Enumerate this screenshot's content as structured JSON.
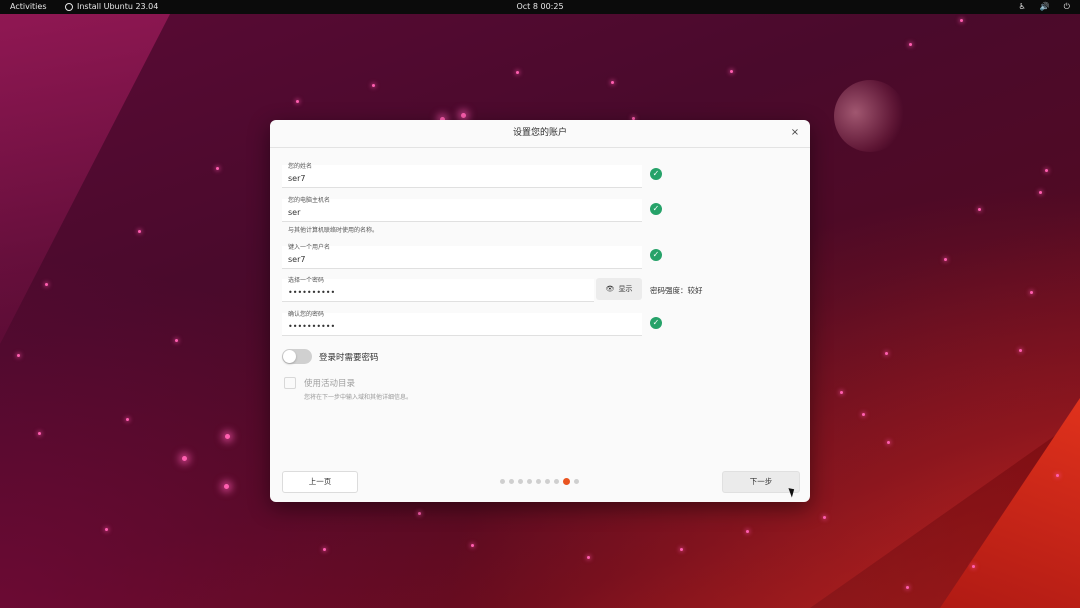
{
  "topbar": {
    "activities": "Activities",
    "app_title": "Install Ubuntu 23.04",
    "clock": "Oct 8  00:25",
    "tray_accessibility": "♿",
    "tray_volume": "🔊",
    "tray_power": "⏻"
  },
  "dialog": {
    "title": "设置您的账户",
    "close_glyph": "×",
    "fields": {
      "name": {
        "label": "您的姓名",
        "value": "ser7"
      },
      "hostname": {
        "label": "您的电脑主机名",
        "value": "ser"
      },
      "hostname_hint": "与其他计算机联络时使用的名称。",
      "username": {
        "label": "键入一个用户名",
        "value": "ser7"
      },
      "password": {
        "label": "选择一个密码",
        "value": "••••••••••"
      },
      "confirm": {
        "label": "确认您的密码",
        "value": "••••••••••"
      }
    },
    "check_glyph": "✓",
    "show_button": {
      "icon": "👁",
      "label": "显示"
    },
    "strength": "密码强度：较好",
    "require_password_toggle": {
      "label": "登录时需要密码",
      "on": false
    },
    "active_directory": {
      "label": "使用活动目录",
      "description": "您将在下一步中输入域和其他详细信息。",
      "checked": false
    },
    "buttons": {
      "prev": "上一页",
      "next": "下一步"
    },
    "progress": {
      "total": 9,
      "current": 8
    }
  },
  "icons": {
    "app": "ubuntu-installer-icon",
    "check": "check-circle-icon",
    "eye": "eye-icon",
    "close": "close-icon"
  },
  "colors": {
    "accent": "#e95420",
    "check": "#26a269",
    "topbar": "#0b0b0b"
  }
}
